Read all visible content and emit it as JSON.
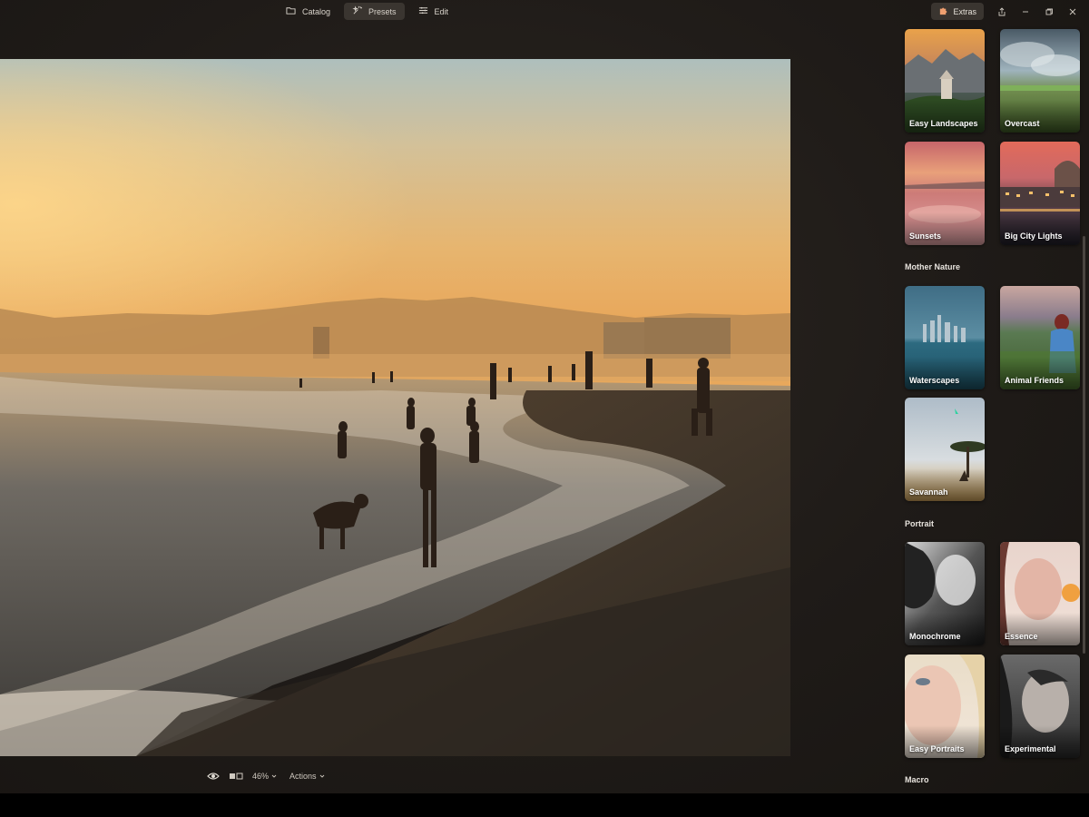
{
  "top_nav": {
    "tabs": [
      {
        "label": "Catalog",
        "icon": "folder-icon",
        "active": false
      },
      {
        "label": "Presets",
        "icon": "sparkle-icon",
        "active": true
      },
      {
        "label": "Edit",
        "icon": "sliders-icon",
        "active": false
      }
    ]
  },
  "window": {
    "extras_label": "Extras",
    "share_icon": "share-icon",
    "minimize_icon": "minimize-icon",
    "restore_icon": "restore-icon",
    "close_icon": "close-icon"
  },
  "view_toolbar": {
    "preview_icon": "eye-icon",
    "compare_icon": "compare-icon",
    "zoom": "46%",
    "actions_label": "Actions"
  },
  "presets": {
    "groups": [
      {
        "title": "",
        "items": [
          "Easy Landscapes",
          "Overcast",
          "Sunsets",
          "Big City Lights"
        ]
      },
      {
        "title": "Mother Nature",
        "items": [
          "Waterscapes",
          "Animal Friends",
          "Savannah"
        ]
      },
      {
        "title": "Portrait",
        "items": [
          "Monochrome",
          "Essence",
          "Easy Portraits",
          "Experimental"
        ]
      },
      {
        "title": "Macro",
        "items": []
      }
    ]
  },
  "colors": {
    "app_bg": "#1f1b18",
    "tab_active_bg": "#3a3530",
    "cursor_accent": "#2bd3a0"
  }
}
